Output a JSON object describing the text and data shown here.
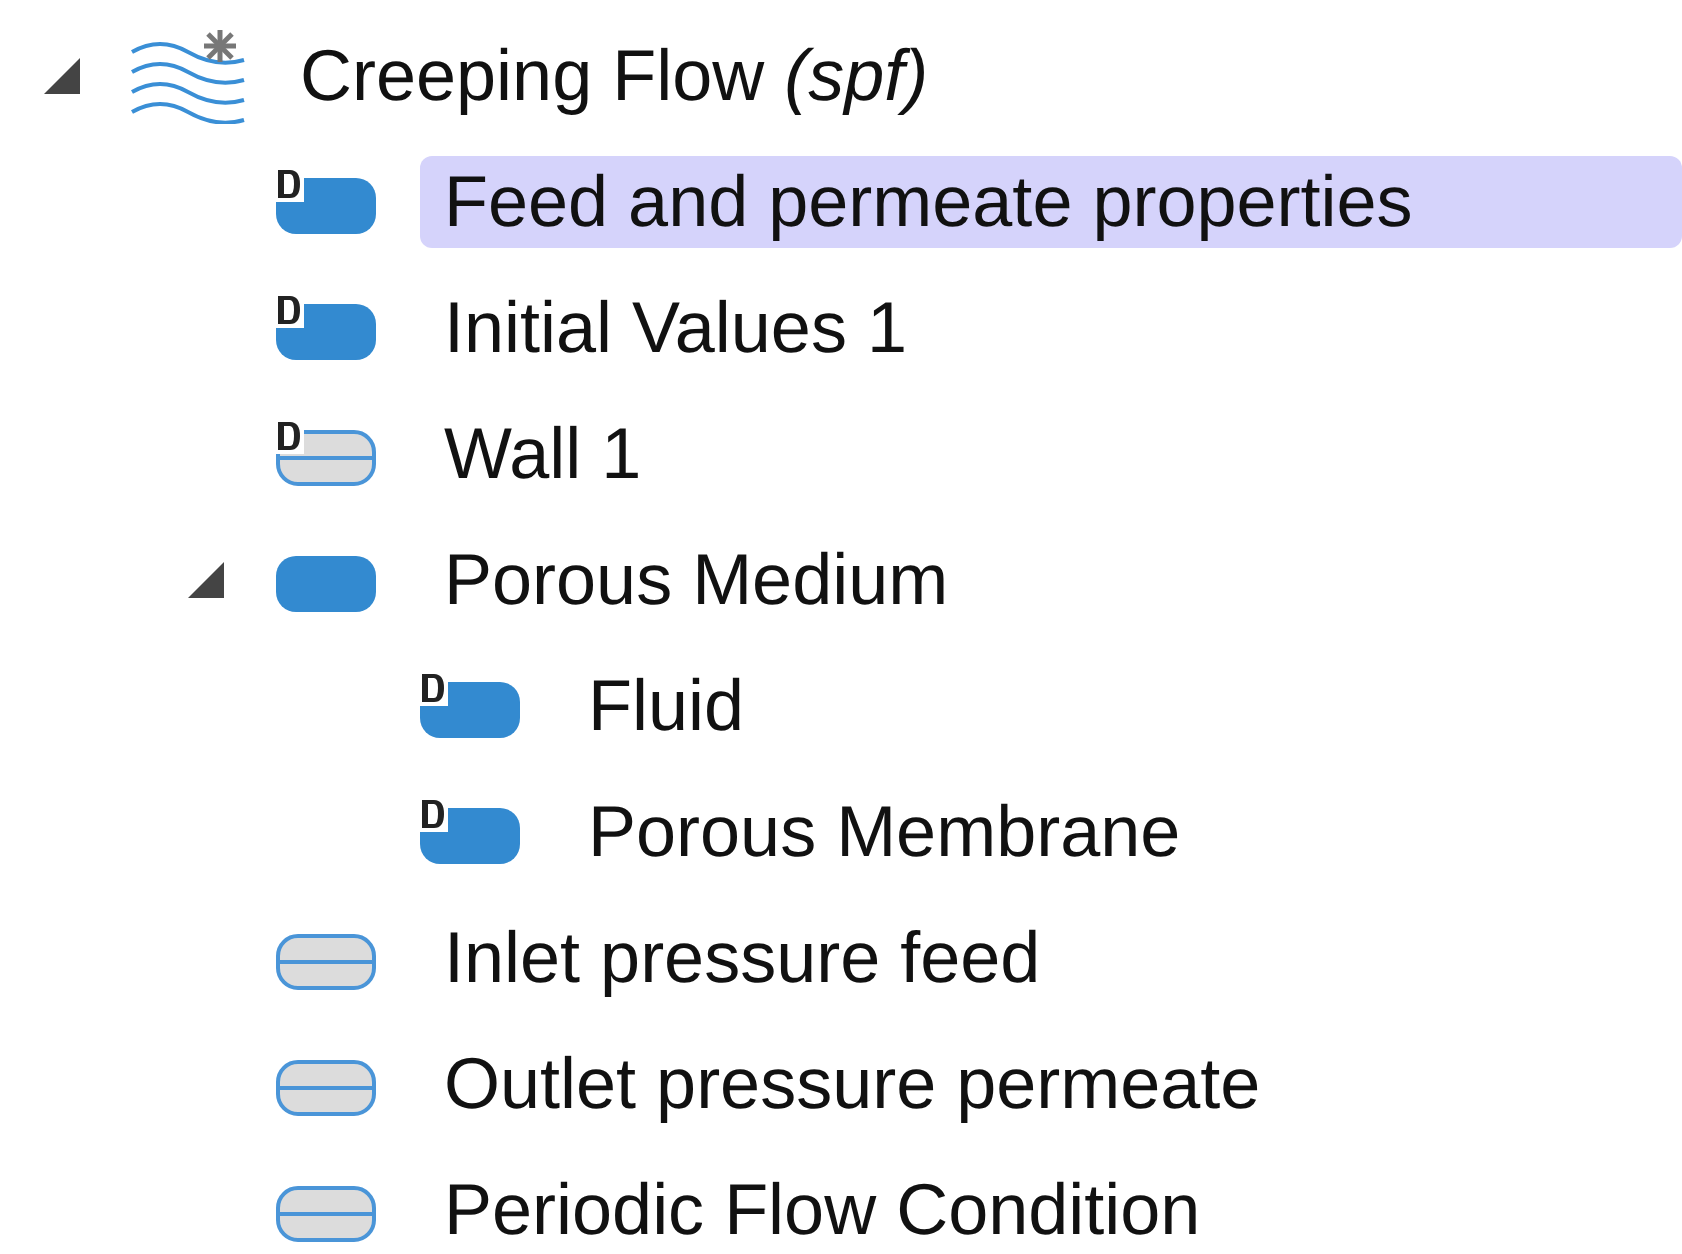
{
  "tree": [
    {
      "label": "Creeping Flow *(spf)*",
      "kind": "physics",
      "expanded": true,
      "selected": false,
      "children": [
        {
          "label": "Feed and permeate properties",
          "kind": "domain",
          "default": true,
          "selected": true
        },
        {
          "label": "Initial Values 1",
          "kind": "domain",
          "default": true,
          "selected": false
        },
        {
          "label": "Wall 1",
          "kind": "boundary",
          "default": true,
          "selected": false
        },
        {
          "label": "Porous Medium",
          "kind": "domain",
          "default": false,
          "expanded": true,
          "selected": false,
          "children": [
            {
              "label": "Fluid",
              "kind": "domain",
              "default": true,
              "selected": false
            },
            {
              "label": "Porous Membrane",
              "kind": "domain",
              "default": true,
              "selected": false
            }
          ]
        },
        {
          "label": "Inlet pressure feed",
          "kind": "boundary",
          "default": false,
          "selected": false
        },
        {
          "label": "Outlet pressure permeate",
          "kind": "boundary",
          "default": false,
          "selected": false
        },
        {
          "label": "Periodic Flow Condition",
          "kind": "boundary",
          "default": false,
          "selected": false
        }
      ]
    }
  ]
}
